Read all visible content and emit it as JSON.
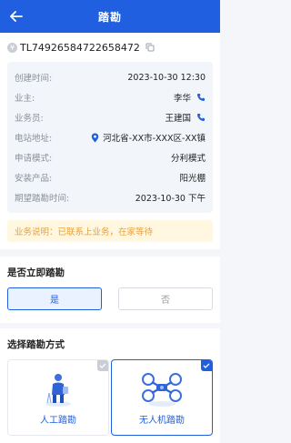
{
  "header": {
    "title": "踏勘"
  },
  "order": {
    "number": "TL74926584722658472"
  },
  "info": [
    {
      "label": "创建时间:",
      "value": "2023-10-30 12:30"
    },
    {
      "label": "业主:",
      "value": "李华"
    },
    {
      "label": "业务员:",
      "value": "王建国"
    },
    {
      "label": "电站地址:",
      "value": "河北省-XX市-XXX区-XX镇"
    },
    {
      "label": "申请模式:",
      "value": "分利模式"
    },
    {
      "label": "安装产品:",
      "value": "阳光棚"
    },
    {
      "label": "期望踏勘时间:",
      "value": "2023-10-30 下午"
    }
  ],
  "notice": {
    "text": "业务说明：已联系上业务，在家等待"
  },
  "immediate": {
    "title": "是否立即踏勘",
    "yes": "是",
    "no": "否",
    "selected": "是"
  },
  "method": {
    "title": "选择踏勘方式",
    "options": [
      {
        "label": "人工踏勘",
        "selected": false
      },
      {
        "label": "无人机踏勘",
        "selected": true
      }
    ]
  },
  "colors": {
    "primary": "#1f5fe0",
    "notice_text": "#e8a13a",
    "notice_bg": "#fff7e0"
  }
}
